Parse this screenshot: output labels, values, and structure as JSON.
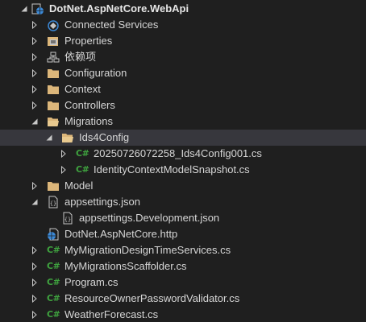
{
  "solution_explorer": {
    "items": [
      {
        "label": "DotNet.AspNetCore.WebApi",
        "icon": "web-project-icon",
        "expander": "open"
      },
      {
        "label": "Connected Services",
        "icon": "connected-services-icon",
        "expander": "closed"
      },
      {
        "label": "Properties",
        "icon": "properties-icon",
        "expander": "closed"
      },
      {
        "label": "依赖项",
        "icon": "dependencies-icon",
        "expander": "closed"
      },
      {
        "label": "Configuration",
        "icon": "folder-icon",
        "expander": "closed"
      },
      {
        "label": "Context",
        "icon": "folder-icon",
        "expander": "closed"
      },
      {
        "label": "Controllers",
        "icon": "folder-icon",
        "expander": "closed"
      },
      {
        "label": "Migrations",
        "icon": "folder-open-icon",
        "expander": "open"
      },
      {
        "label": "Ids4Config",
        "icon": "folder-open-icon",
        "expander": "open"
      },
      {
        "label": "20250726072258_Ids4Config001.cs",
        "icon": "csharp-file-icon",
        "expander": "closed"
      },
      {
        "label": "IdentityContextModelSnapshot.cs",
        "icon": "csharp-file-icon",
        "expander": "closed"
      },
      {
        "label": "Model",
        "icon": "folder-icon",
        "expander": "closed"
      },
      {
        "label": "appsettings.json",
        "icon": "json-file-icon",
        "expander": "open"
      },
      {
        "label": "appsettings.Development.json",
        "icon": "json-file-icon",
        "expander": "none"
      },
      {
        "label": "DotNet.AspNetCore.http",
        "icon": "http-file-icon",
        "expander": "none"
      },
      {
        "label": "MyMigrationDesignTimeServices.cs",
        "icon": "csharp-file-icon",
        "expander": "closed"
      },
      {
        "label": "MyMigrationsScaffolder.cs",
        "icon": "csharp-file-icon",
        "expander": "closed"
      },
      {
        "label": "Program.cs",
        "icon": "csharp-file-icon",
        "expander": "closed"
      },
      {
        "label": "ResourceOwnerPasswordValidator.cs",
        "icon": "csharp-file-icon",
        "expander": "closed"
      },
      {
        "label": "WeatherForecast.cs",
        "icon": "csharp-file-icon",
        "expander": "closed"
      }
    ],
    "csharp_glyph": "C#",
    "selected_item": "Ids4Config",
    "colors": {
      "background": "#1f1f1f",
      "selection": "#37373d",
      "folder": "#dcb67a",
      "csharp": "#3fa33f",
      "globe": "#3c8ad8",
      "text": "#d6d6d6"
    }
  }
}
